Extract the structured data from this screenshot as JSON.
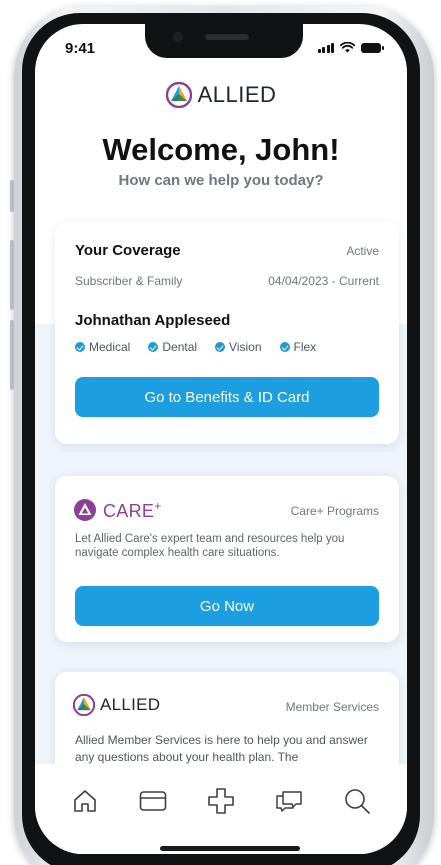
{
  "status_bar": {
    "time": "9:41"
  },
  "brand": {
    "name": "ALLIED"
  },
  "header": {
    "welcome": "Welcome, John!",
    "subtitle": "How can we help you today?"
  },
  "coverage": {
    "title": "Your Coverage",
    "status": "Active",
    "plan": "Subscriber & Family",
    "dates": "04/04/2023 - Current",
    "member_name": "Johnathan Appleseed",
    "benefits": [
      "Medical",
      "Dental",
      "Vision",
      "Flex"
    ],
    "button_label": "Go to Benefits & ID Card"
  },
  "care": {
    "logo_text": "CARE",
    "logo_plus": "+",
    "label": "Care+ Programs",
    "description": "Let Allied Care's expert team and resources help you navigate complex health care situations.",
    "button_label": "Go Now"
  },
  "member_services": {
    "logo_text": "ALLIED",
    "label": "Member Services",
    "description": "Allied Member Services is here to help you and answer any questions about your health plan. The"
  },
  "nav": [
    "home-icon",
    "card-icon",
    "medical-cross-icon",
    "chat-icon",
    "search-icon"
  ],
  "colors": {
    "primary_button": "#1c9ee0",
    "care_purple": "#8d3f97",
    "check_blue": "#1f9ad6",
    "background_band": "#eef4fa"
  }
}
